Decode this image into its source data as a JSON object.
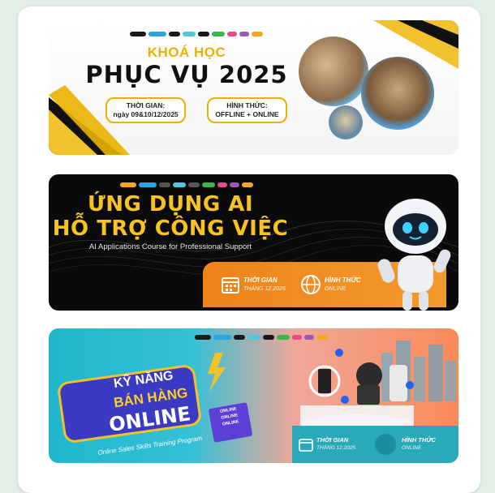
{
  "logo_chips": [
    "#1a1a1a",
    "#2aa5e0",
    "#1a1a1a",
    "#4ec8e0",
    "#1a1a1a",
    "#3cb54a",
    "#e84a8a",
    "#9b59b6",
    "#f5a623"
  ],
  "banner1": {
    "kicker": "KHOÁ HỌC",
    "title": "PHỤC VỤ 2025",
    "time_label": "THỜI GIAN:",
    "time_value": "ngày 09&10/12/2025",
    "format_label": "HÌNH THỨC:",
    "format_value": "OFFLINE + ONLINE"
  },
  "banner2": {
    "title_line1": "ỨNG DỤNG AI",
    "title_line2": "HỖ TRỢ CÔNG VIỆC",
    "subtitle": "AI Applications Course for Professional Support",
    "time_label": "THỜI GIAN",
    "time_value": "THÁNG 12.2025",
    "format_label": "HÌNH THỨC",
    "format_value": "ONLINE"
  },
  "banner3": {
    "line1": "KỸ NĂNG",
    "line2": "BÁN HÀNG",
    "line3": "ONLINE",
    "subtitle": "Online Sales Skills Training Program",
    "time_label": "THỜI GIAN",
    "time_value": "THÁNG 12.2025",
    "format_label": "HÌNH THỨC",
    "format_value": "ONLINE",
    "box_labels": [
      "ONLINE",
      "ONLINE",
      "ONLINE"
    ]
  }
}
